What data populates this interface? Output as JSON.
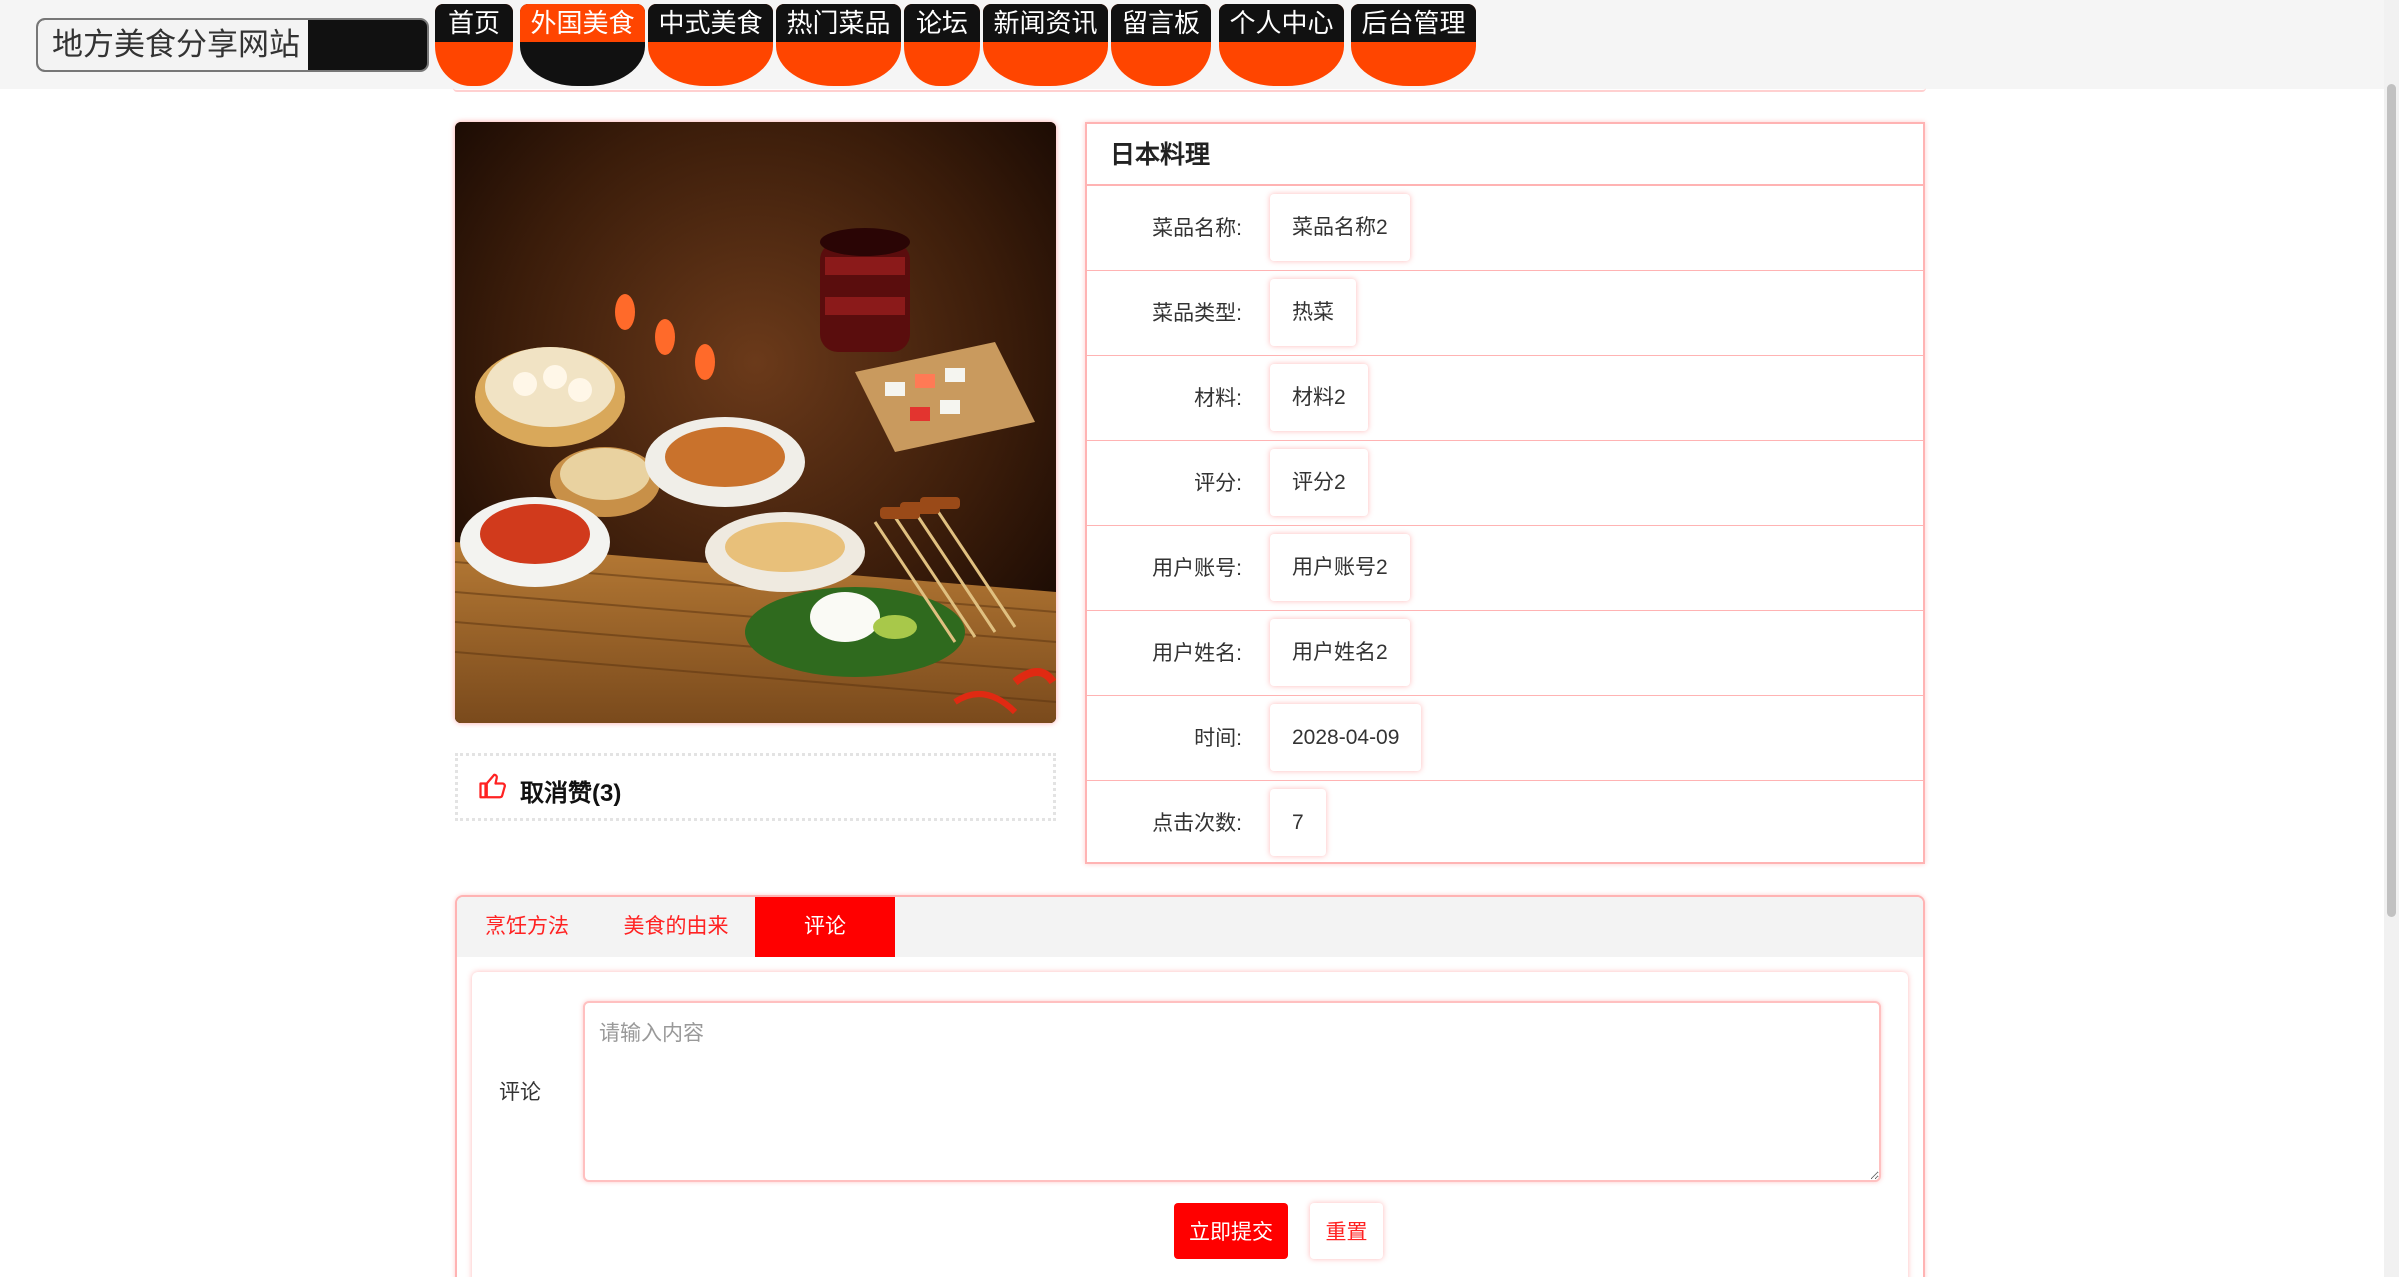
{
  "header": {
    "site_title": "地方美食分享网站",
    "nav": [
      {
        "label": "首页",
        "active": false
      },
      {
        "label": "外国美食",
        "active": true
      },
      {
        "label": "中式美食",
        "active": false
      },
      {
        "label": "热门菜品",
        "active": false
      },
      {
        "label": "论坛",
        "active": false
      },
      {
        "label": "新闻资讯",
        "active": false
      },
      {
        "label": "留言板",
        "active": false
      },
      {
        "label": "个人中心",
        "active": false
      },
      {
        "label": "后台管理",
        "active": false
      }
    ]
  },
  "image": {
    "icon": "food-feast-photo"
  },
  "like": {
    "icon": "thumbs-up-icon",
    "label": "取消赞(3)"
  },
  "detail": {
    "title": "日本料理",
    "rows": [
      {
        "label": "菜品名称:",
        "value": "菜品名称2"
      },
      {
        "label": "菜品类型:",
        "value": "热菜"
      },
      {
        "label": "材料:",
        "value": "材料2"
      },
      {
        "label": "评分:",
        "value": "评分2"
      },
      {
        "label": "用户账号:",
        "value": "用户账号2"
      },
      {
        "label": "用户姓名:",
        "value": "用户姓名2"
      },
      {
        "label": "时间:",
        "value": "2028-04-09"
      },
      {
        "label": "点击次数:",
        "value": "7"
      }
    ]
  },
  "tabs": [
    {
      "label": "烹饪方法",
      "active": false
    },
    {
      "label": "美食的由来",
      "active": false
    },
    {
      "label": "评论",
      "active": true
    }
  ],
  "comment": {
    "label": "评论",
    "value": "",
    "placeholder": "请输入内容",
    "submit_label": "立即提交",
    "reset_label": "重置"
  },
  "colors": {
    "accent": "#ff4500",
    "primary_red": "#ff0000",
    "nav_dark": "#111111",
    "border_pink": "#ffb3b3"
  }
}
